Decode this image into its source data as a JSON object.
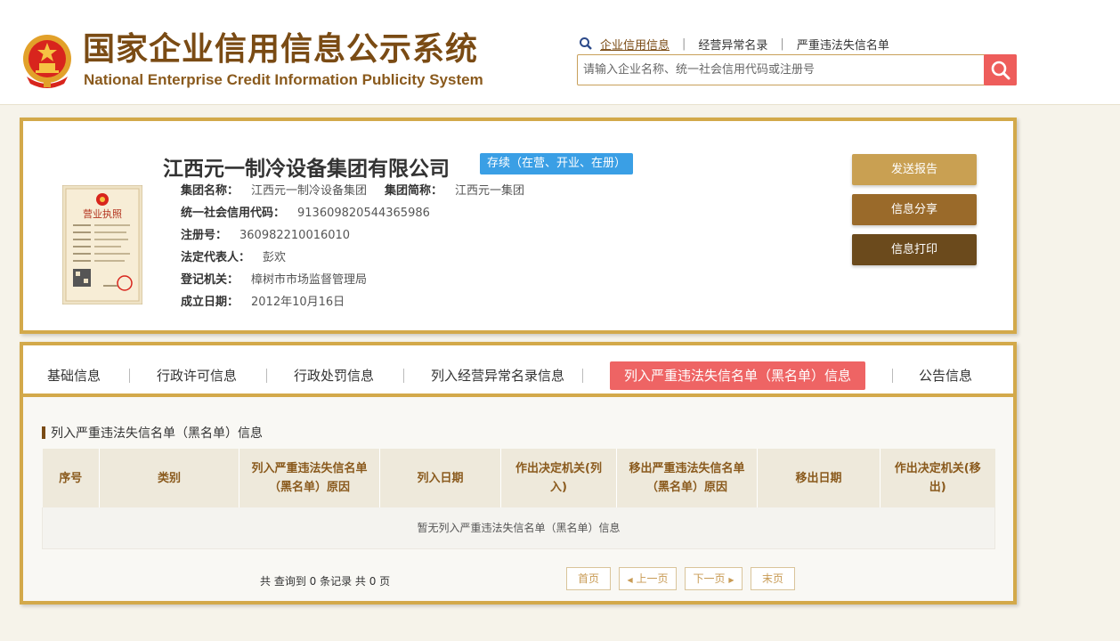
{
  "header": {
    "title_cn": "国家企业信用信息公示系统",
    "title_en": "National Enterprise Credit Information Publicity System",
    "nav": [
      "企业信用信息",
      "经营异常名录",
      "严重违法失信名单"
    ],
    "search_placeholder": "请输入企业名称、统一社会信用代码或注册号"
  },
  "company": {
    "name": "江西元一制冷设备集团有限公司",
    "status": "存续（在营、开业、在册）",
    "license_label": "营业执照",
    "fields": {
      "group_name_label": "集团名称：",
      "group_name": "江西元一制冷设备集团",
      "group_short_label": "集团简称：",
      "group_short": "江西元一集团",
      "uscc_label": "统一社会信用代码：",
      "uscc": "913609820544365986",
      "reg_no_label": "注册号：",
      "reg_no": "360982210016010",
      "legal_rep_label": "法定代表人：",
      "legal_rep": "彭欢",
      "authority_label": "登记机关：",
      "authority": "樟树市市场监督管理局",
      "est_date_label": "成立日期：",
      "est_date": "2012年10月16日"
    },
    "actions": {
      "send_report": "发送报告",
      "share": "信息分享",
      "print": "信息打印"
    }
  },
  "tabs": [
    "基础信息",
    "行政许可信息",
    "行政处罚信息",
    "列入经营异常名录信息",
    "列入严重违法失信名单（黑名单）信息",
    "公告信息"
  ],
  "active_tab": "列入严重违法失信名单（黑名单）信息",
  "section": {
    "title": "列入严重违法失信名单（黑名单）信息",
    "columns": [
      "序号",
      "类别",
      "列入严重违法失信名单（黑名单）原因",
      "列入日期",
      "作出决定机关(列入)",
      "移出严重违法失信名单（黑名单）原因",
      "移出日期",
      "作出决定机关(移出)"
    ],
    "empty_text": "暂无列入严重违法失信名单（黑名单）信息",
    "total_text": "共 查询到 0 条记录 共 0 页"
  },
  "pagination": {
    "first": "首页",
    "prev": "上一页",
    "next": "下一页",
    "last": "末页"
  },
  "colors": {
    "brand_brown": "#7a4b14",
    "gold_border": "#d3a94a",
    "active_tab": "#ee6464",
    "status_blue": "#3a9fe5",
    "btn_send": "#c9a052",
    "btn_share": "#9a6a2a",
    "btn_print": "#6b4a1c"
  }
}
